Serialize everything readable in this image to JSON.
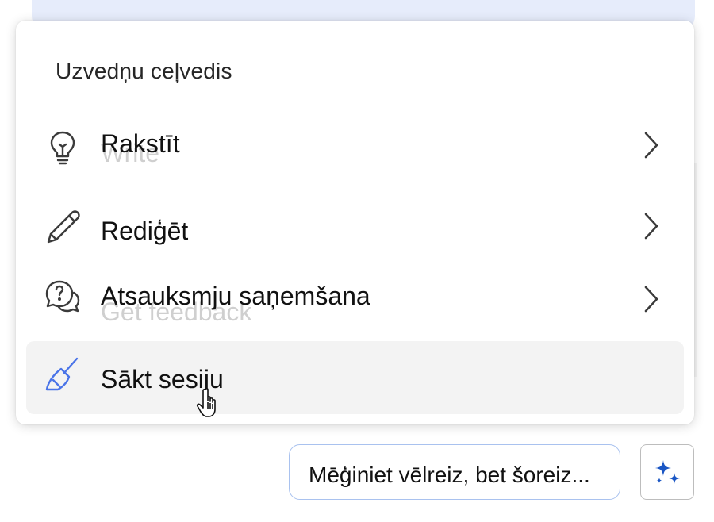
{
  "menu": {
    "title": "Uzvedņu ceļvedis",
    "items": [
      {
        "label": "Rakstīt",
        "ghost": "Write",
        "icon": "lightbulb-icon",
        "has_submenu": true
      },
      {
        "label": "Rediģēt",
        "icon": "pencil-icon",
        "has_submenu": true
      },
      {
        "label": "Atsauksmju saņemšana",
        "ghost": "Get feedback",
        "icon": "question-chat-icon",
        "has_submenu": true
      },
      {
        "label": "Sākt sesiju",
        "icon": "broom-icon",
        "has_submenu": false,
        "state": "hovered"
      }
    ]
  },
  "footer": {
    "suggestion": "Mēģiniet vēlreiz, bet šoreiz...",
    "copilot_icon": "sparkle-icon"
  },
  "colors": {
    "accent": "#4a74e8",
    "sparkle": "#1a56c4",
    "hover_bg": "#f3f3f3",
    "chip_border": "#a9c2ef"
  }
}
